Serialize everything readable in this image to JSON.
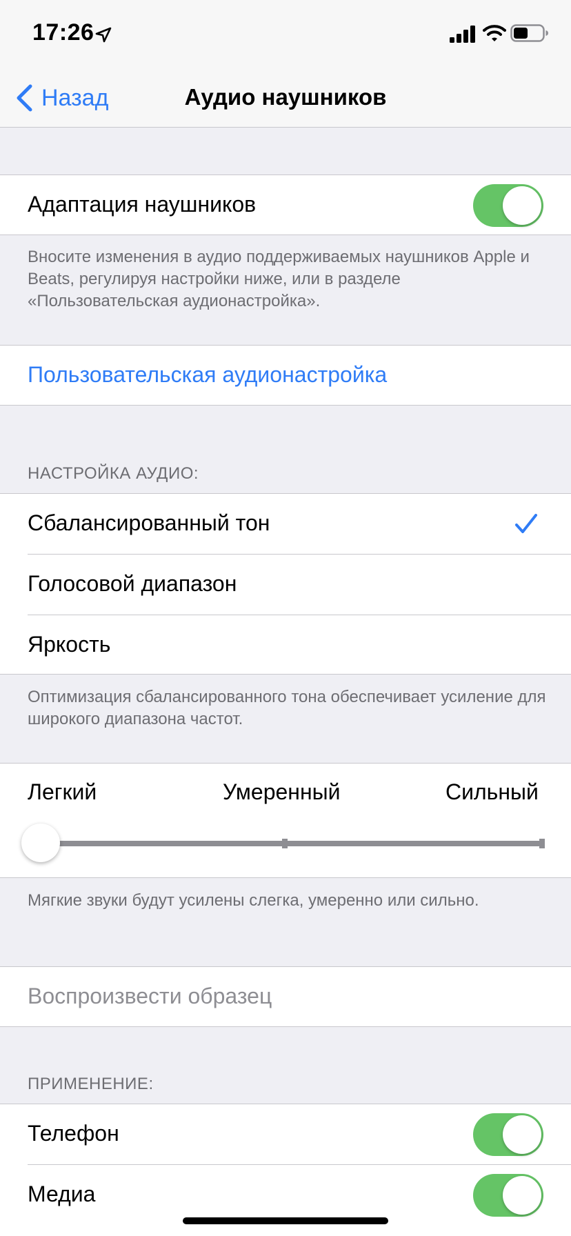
{
  "status_bar": {
    "time": "17:26",
    "icons": [
      "location-arrow-icon",
      "cellular-signal-icon",
      "wifi-icon",
      "battery-icon"
    ]
  },
  "nav": {
    "back_label": "Назад",
    "title": "Аудио наушников"
  },
  "headphone_adaptation": {
    "label": "Адаптация наушников",
    "enabled": true,
    "footer": "Вносите изменения в аудио поддерживаемых наушников Apple и Beats, регулируя настройки ниже, или в разделе «Пользовательская аудионастройка»."
  },
  "custom_audio_setup": {
    "label": "Пользовательская аудионастройка"
  },
  "tune_audio": {
    "header": "НАСТРОЙКА АУДИО:",
    "options": [
      {
        "label": "Сбалансированный тон",
        "selected": true
      },
      {
        "label": "Голосовой диапазон",
        "selected": false
      },
      {
        "label": "Яркость",
        "selected": false
      }
    ],
    "footer": "Оптимизация сбалансированного тона обеспечивает усиление для широкого диапазона частот."
  },
  "boost_slider": {
    "labels": [
      "Легкий",
      "Умеренный",
      "Сильный"
    ],
    "value_index": 0,
    "footer": "Мягкие звуки будут усилены слегка, умеренно или сильно."
  },
  "play_sample": {
    "label": "Воспроизвести образец"
  },
  "apply_with": {
    "header": "ПРИМЕНЕНИЕ:",
    "items": [
      {
        "label": "Телефон",
        "enabled": true
      },
      {
        "label": "Медиа",
        "enabled": true
      }
    ]
  },
  "colors": {
    "accent": "#2f7cf6",
    "toggle_on": "#65c466",
    "background": "#efeff4",
    "secondary_text": "#6d6d72"
  }
}
